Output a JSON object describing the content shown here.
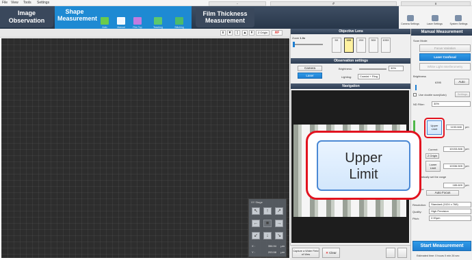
{
  "menu": [
    "File",
    "View",
    "Tools",
    "Settings"
  ],
  "window_controls": [
    "-",
    "#",
    "x"
  ],
  "modes": {
    "image_observation": "Image Observation",
    "shape_measurement": "Shape Measurement",
    "film_thickness": "Film Thickness Measurement"
  },
  "submodes": [
    "Auto",
    "Manual",
    "Film Top",
    "Teaching",
    "Stitching"
  ],
  "right_tools": [
    "Camera Settings",
    "Laser Settings",
    "System Settings"
  ],
  "view_toolbar": {
    "z_origin": "Z Origin",
    "af": "AF"
  },
  "stage": {
    "title": "XY Stage",
    "x_label": "X :",
    "x_value": "356.94",
    "y_label": "Y :",
    "y_value": "203.58",
    "unit": "µm"
  },
  "objective": {
    "header": "Objective Lens",
    "zoom_label": "Zoom",
    "zoom_value": "1.0x",
    "lenses": [
      "5X",
      "10X",
      "20X",
      "50X",
      "100X"
    ]
  },
  "observation": {
    "header": "Observation settings",
    "camera_btn": "Camera",
    "laser_btn": "Laser",
    "brightness_label": "Brightness:",
    "brightness_value": "30%",
    "lighting_label": "Lighting:",
    "lighting_value": "Coaxial + Ring"
  },
  "navigation": {
    "header": "Navigation"
  },
  "popup": {
    "line1": "Upper",
    "line2": "Limit"
  },
  "bottom": {
    "capture": "Capture a Wider Field of View",
    "clear": "Clear"
  },
  "measurement": {
    "header": "Manual Measurement",
    "scan_mode_label": "Scan Mode:",
    "focus_variation": "Focus Variation",
    "laser_confocal": "Laser Confocal",
    "white_light": "White Light Interferometry",
    "brightness_label": "Brightness",
    "brightness_value": "6395",
    "auto": "Auto",
    "double_scan": "Use double scan(Auto)",
    "settings": "Settings",
    "nd_label": "ND Filter:",
    "nd_value": "30%",
    "upper_btn": "Upper Limit",
    "upper_value": "1153.846",
    "unit": "µm",
    "current_label": "Current:",
    "current_value": "10153.846",
    "z_origin": "Z Origin",
    "lower_btn": "Lower Limit",
    "lower_value": "10336.505",
    "auto_set": "Automatically set the range",
    "feed_label": "Feed Distance",
    "feed_value": "185.609",
    "auto_focus": "Auto Focus",
    "resolution_label": "Resolution:",
    "resolution_value": "Standard (1024 x 768)",
    "quality_label": "Quality:",
    "quality_value": "High Precision",
    "pitch_label": "Pitch:",
    "pitch_value": "2.00µm",
    "start": "Start Measurement",
    "estimated": "Estimated time: 0 hours 0 min 26 sec"
  }
}
